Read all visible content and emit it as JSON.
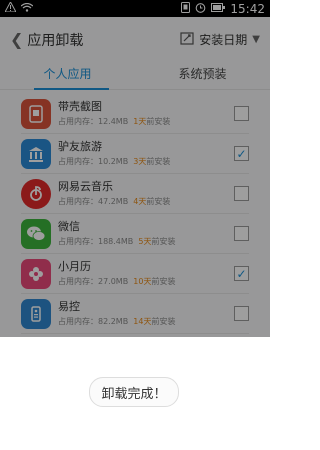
{
  "status_bar": {
    "time": "15:42",
    "icons": [
      "warning-icon",
      "wifi-icon",
      "screenshot-icon",
      "alarm-icon",
      "battery-icon"
    ]
  },
  "header": {
    "back_icon": "chevron-left-icon",
    "title": "应用卸载",
    "sort_icon": "calendar-sort-icon",
    "sort_label": "安装日期",
    "chevron": "chevron-down-icon"
  },
  "tabs": [
    {
      "label": "个人应用",
      "active": true
    },
    {
      "label": "系统预装",
      "active": false
    }
  ],
  "apps": [
    {
      "name": "带壳截图",
      "storage": "占用内存：12.4MB",
      "days": "1天",
      "suffix": "前安装",
      "checked": false,
      "icon": "screenshot-frame-icon",
      "color": "#d9533a"
    },
    {
      "name": "驴友旅游",
      "storage": "占用内存：10.2MB",
      "days": "3天",
      "suffix": "前安装",
      "checked": true,
      "icon": "bank-icon",
      "color": "#2a8ad6"
    },
    {
      "name": "网易云音乐",
      "storage": "占用内存：47.2MB",
      "days": "4天",
      "suffix": "前安装",
      "checked": false,
      "icon": "music-icon",
      "color": "#e02b2b"
    },
    {
      "name": "微信",
      "storage": "占用内存：188.4MB",
      "days": "5天",
      "suffix": "前安装",
      "checked": false,
      "icon": "wechat-icon",
      "color": "#3db33d"
    },
    {
      "name": "小月历",
      "storage": "占用内存：27.0MB",
      "days": "10天",
      "suffix": "前安装",
      "checked": true,
      "icon": "flower-calendar-icon",
      "color": "#e84a7a"
    },
    {
      "name": "易控",
      "storage": "占用内存：82.2MB",
      "days": "14天",
      "suffix": "前安装",
      "checked": false,
      "icon": "remote-control-icon",
      "color": "#2f86cf"
    }
  ],
  "toast": {
    "message": "卸载完成！"
  }
}
